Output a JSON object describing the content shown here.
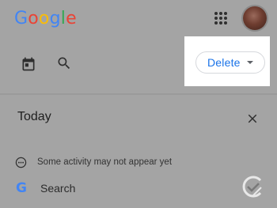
{
  "header": {
    "logo_letters": [
      {
        "char": "G",
        "color": "#4285F4"
      },
      {
        "char": "o",
        "color": "#EA4335"
      },
      {
        "char": "o",
        "color": "#FBBC05"
      },
      {
        "char": "g",
        "color": "#4285F4"
      },
      {
        "char": "l",
        "color": "#34A853"
      },
      {
        "char": "e",
        "color": "#EA4335"
      }
    ],
    "apps_icon": "apps-grid-icon",
    "avatar_icon": "account-avatar"
  },
  "toolbar": {
    "calendar_icon": "calendar-icon",
    "search_icon": "search-icon",
    "delete_label": "Delete",
    "delete_menu_icon": "dropdown-arrow-icon",
    "accent_color": "#1a73e8"
  },
  "section": {
    "title": "Today",
    "close_icon": "close-icon"
  },
  "activity": {
    "notice": "Some activity may not appear yet",
    "notice_icon": "more-horizontal-circle-icon",
    "item_product": "Search",
    "item_icon": "google-g-icon"
  }
}
